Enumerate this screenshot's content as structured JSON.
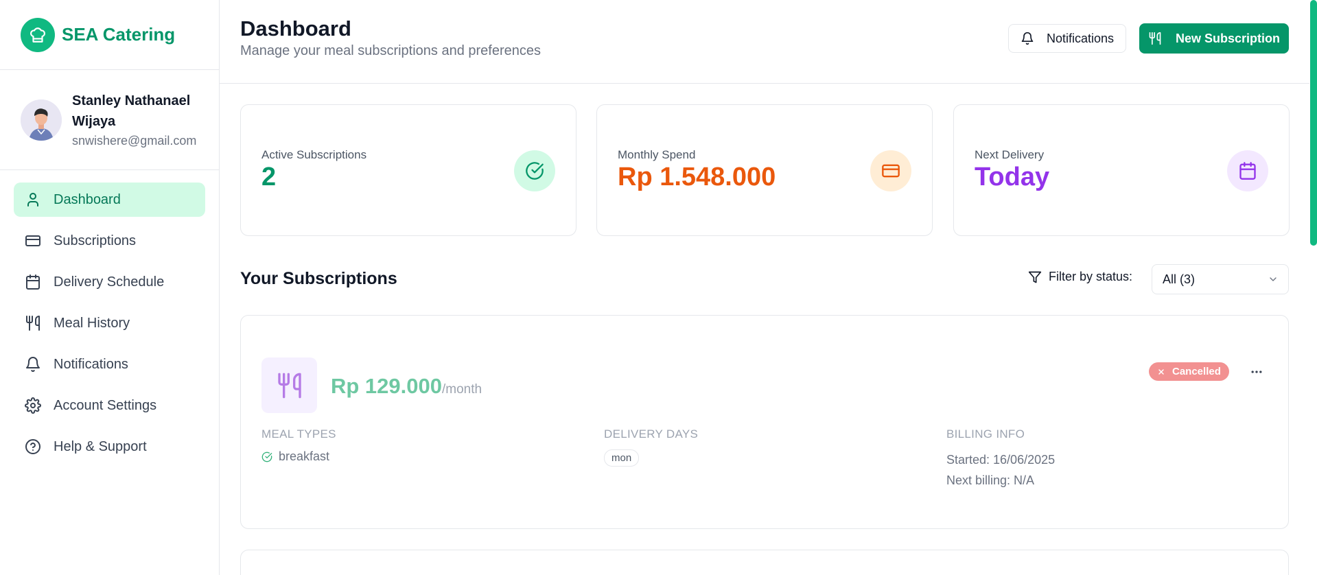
{
  "brand": {
    "name": "SEA Catering"
  },
  "user": {
    "name": "Stanley Nathanael Wijaya",
    "email": "snwishere@gmail.com"
  },
  "nav": [
    {
      "label": "Dashboard",
      "icon": "user-icon",
      "active": true
    },
    {
      "label": "Subscriptions",
      "icon": "credit-card-icon"
    },
    {
      "label": "Delivery Schedule",
      "icon": "calendar-icon"
    },
    {
      "label": "Meal History",
      "icon": "utensils-icon"
    },
    {
      "label": "Notifications",
      "icon": "bell-icon"
    },
    {
      "label": "Account Settings",
      "icon": "gear-icon"
    },
    {
      "label": "Help & Support",
      "icon": "help-circle-icon"
    }
  ],
  "header": {
    "title": "Dashboard",
    "subtitle": "Manage your meal subscriptions and preferences",
    "notifications_label": "Notifications",
    "new_subscription_label": "New Subscription"
  },
  "stats": [
    {
      "label": "Active Subscriptions",
      "value": "2",
      "color": "#059669",
      "icon": "check-circle-icon"
    },
    {
      "label": "Monthly Spend",
      "value": "Rp 1.548.000",
      "color": "#ea580c",
      "icon": "credit-card-icon"
    },
    {
      "label": "Next Delivery",
      "value": "Today",
      "color": "#9333ea",
      "icon": "calendar-icon"
    }
  ],
  "subscriptions_section": {
    "title": "Your Subscriptions",
    "filter_label": "Filter by status:",
    "filter_value": "All (3)"
  },
  "subscription": {
    "price": "Rp 129.000",
    "period": "/month",
    "status": "Cancelled",
    "meal_types_header": "MEAL TYPES",
    "meal_types": [
      "breakfast"
    ],
    "delivery_days_header": "DELIVERY DAYS",
    "delivery_days": [
      "mon"
    ],
    "billing_header": "BILLING INFO",
    "started": "Started: 16/06/2025",
    "next_billing": "Next billing: N/A"
  },
  "colors": {
    "accent": "#059669",
    "active_nav_bg": "#d1fae5",
    "cancelled_badge": "#f29191"
  }
}
